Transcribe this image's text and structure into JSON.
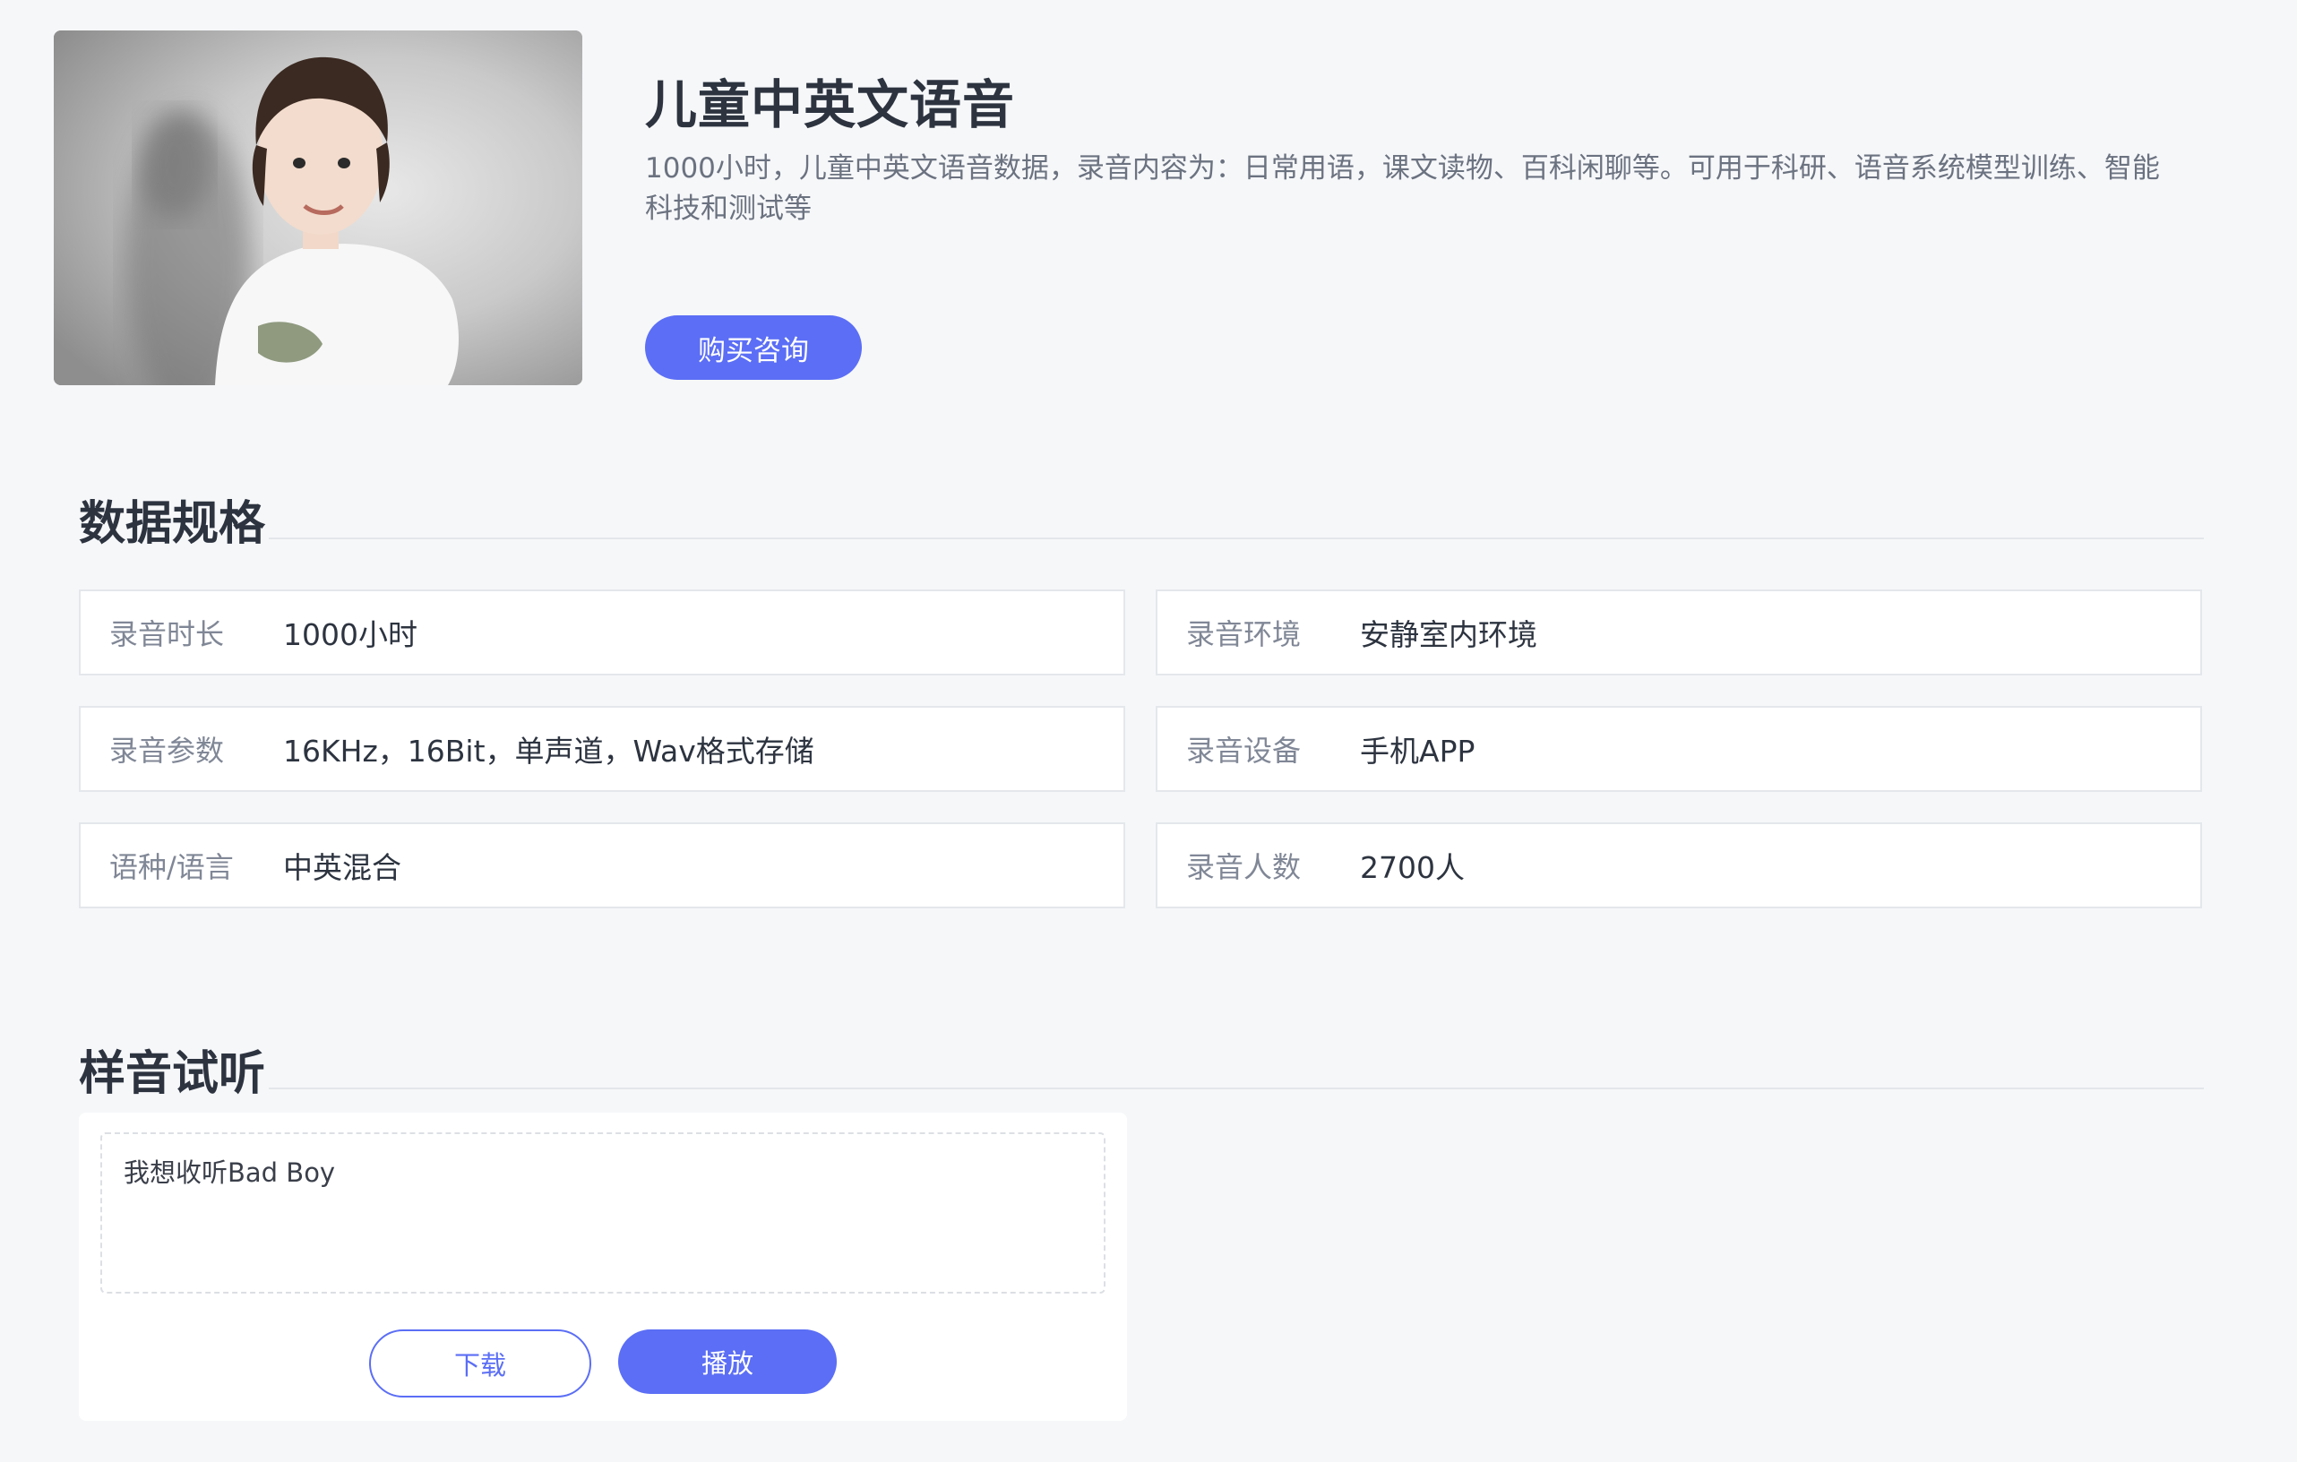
{
  "hero": {
    "title": "儿童中英文语音",
    "description": "1000小时，儿童中英文语音数据，录音内容为：日常用语，课文读物、百科闲聊等。可用于科研、语音系统模型训练、智能科技和测试等",
    "consult_button": "购买咨询",
    "image_subject": "child-portrait"
  },
  "specs": {
    "title": "数据规格",
    "items": [
      {
        "label": "录音时长",
        "value": "1000小时"
      },
      {
        "label": "录音环境",
        "value": "安静室内环境"
      },
      {
        "label": "录音参数",
        "value": "16KHz，16Bit，单声道，Wav格式存储"
      },
      {
        "label": "录音设备",
        "value": "手机APP"
      },
      {
        "label": "语种/语言",
        "value": "中英混合"
      },
      {
        "label": "录音人数",
        "value": "2700人"
      }
    ]
  },
  "sample": {
    "title": "样音试听",
    "transcript": "我想收听Bad Boy",
    "download_label": "下载",
    "play_label": "播放"
  },
  "colors": {
    "accent": "#5b6ef5",
    "background": "#f6f7f9",
    "title": "#2d3440",
    "muted": "#808796"
  }
}
